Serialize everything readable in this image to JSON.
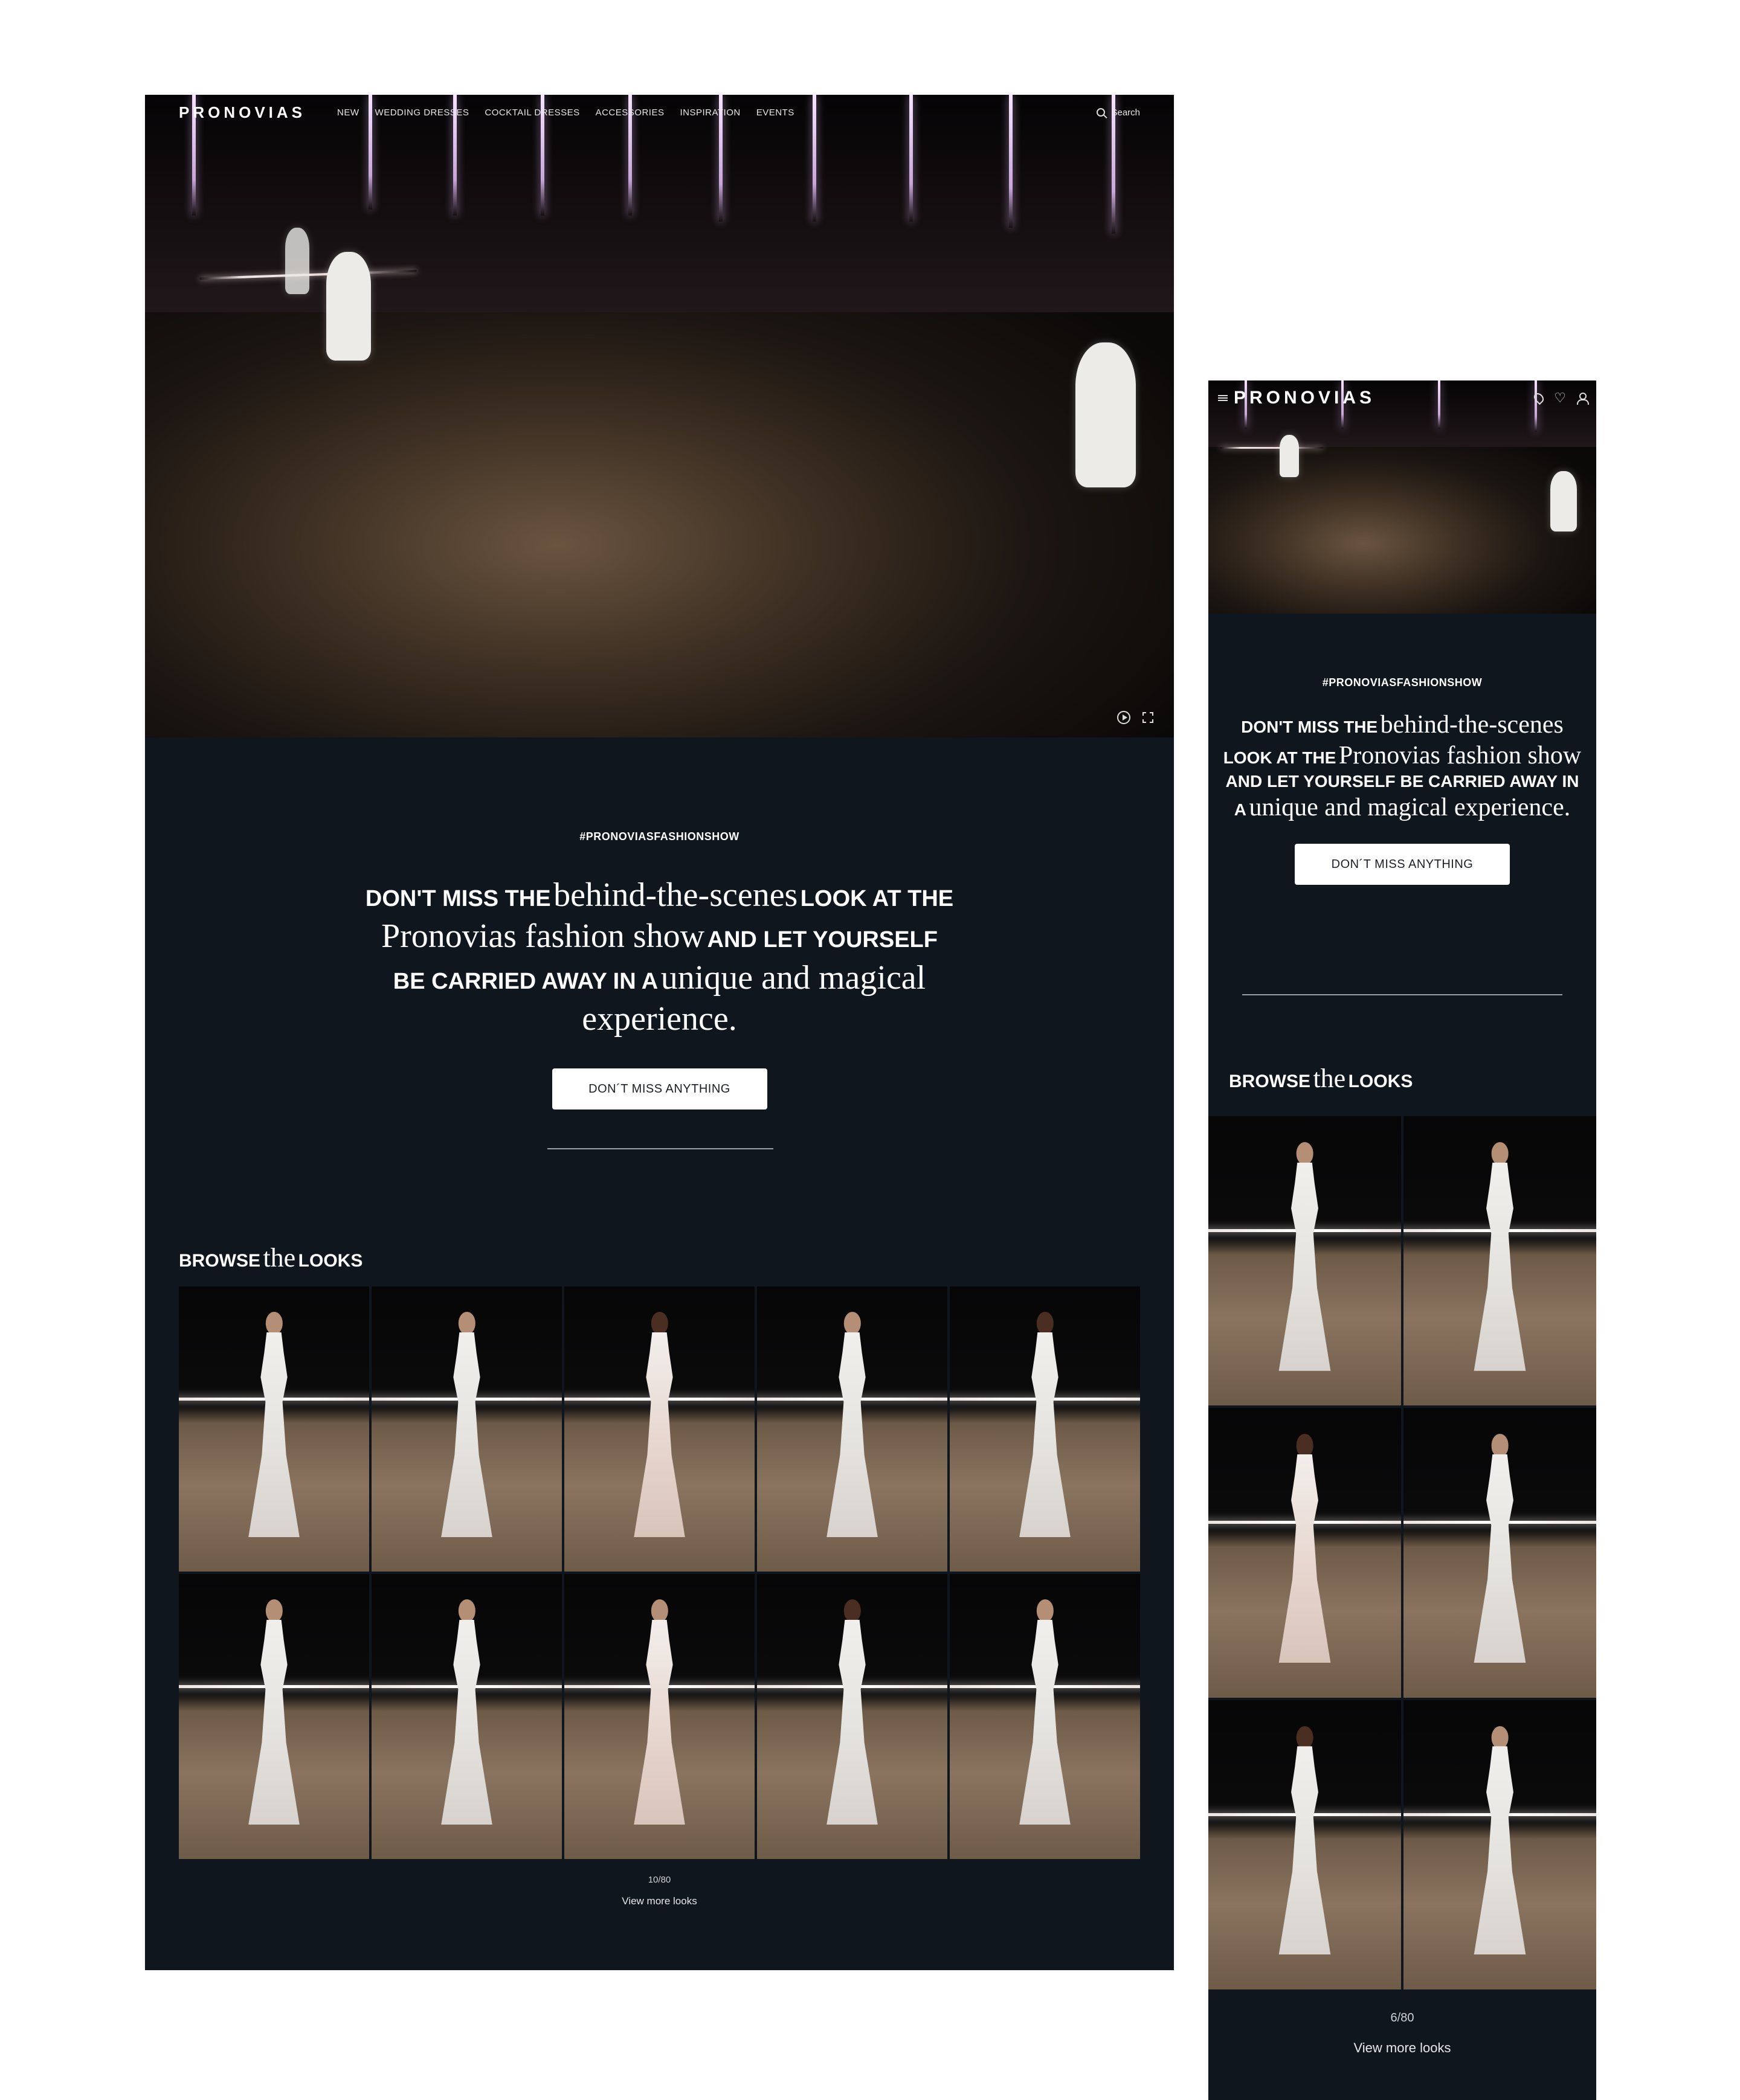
{
  "brand": "PRONOVIAS",
  "nav": [
    "NEW",
    "WEDDING DRESSES",
    "COCKTAIL DRESSES",
    "ACCESSORIES",
    "INSPIRATION",
    "EVENTS"
  ],
  "search_label": "Search",
  "hashtag": "#PRONOVIASFASHIONSHOW",
  "headline": {
    "c1": "DON'T MISS THE",
    "s1": "behind-the-scenes",
    "c2": "LOOK AT THE",
    "s2": "Pronovias fashion show",
    "c3": "AND LET YOURSELF BE CARRIED AWAY IN A",
    "s3": "unique and magical experience."
  },
  "cta_label": "DON´T MISS ANYTHING",
  "browse": {
    "caps1": "BROWSE",
    "ser": "the",
    "caps2": "LOOKS"
  },
  "desktop": {
    "count": "10/80",
    "more": "View more looks"
  },
  "mobile": {
    "count": "6/80",
    "more": "View more looks"
  },
  "colors": {
    "background": "#10161d",
    "button": "#ffffff",
    "button_text": "#1a1f27"
  },
  "icons": [
    "search-icon",
    "play-icon",
    "fullscreen-icon",
    "menu-icon",
    "location-icon",
    "heart-icon",
    "user-icon"
  ]
}
